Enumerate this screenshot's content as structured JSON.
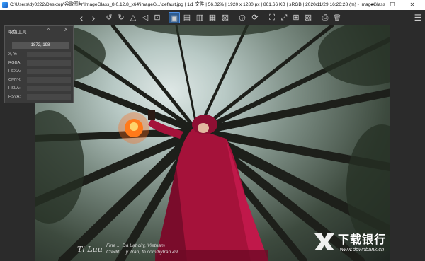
{
  "window": {
    "title": "C:\\Users\\dy0222\\Desktop\\谷歌图片\\ImageGlass_8.0.12.8_x64\\imageG...\\default.jpg  |  1/1 文件  |  56.02%  |  1920 x 1280 px  |  861.66 KB  |  sRGB  |  2020/11/29 16:26:28 (m)  -  ImageGlass",
    "minimize": "—",
    "maximize": "☐",
    "close": "✕"
  },
  "toolbar": {
    "buttons": [
      {
        "name": "prev-image-icon",
        "glyph": "‹"
      },
      {
        "name": "next-image-icon",
        "glyph": "›"
      },
      {
        "name": "rotate-left-icon",
        "glyph": "↺"
      },
      {
        "name": "rotate-right-icon",
        "glyph": "↻"
      },
      {
        "name": "flip-vertical-icon",
        "glyph": "△"
      },
      {
        "name": "flip-horizontal-icon",
        "glyph": "◁"
      },
      {
        "name": "crop-icon",
        "glyph": "⊡"
      },
      {
        "name": "auto-zoom-icon",
        "glyph": "▣"
      },
      {
        "name": "zoom-lock-icon",
        "glyph": "▤"
      },
      {
        "name": "scale-width-icon",
        "glyph": "▥"
      },
      {
        "name": "scale-height-icon",
        "glyph": "▦"
      },
      {
        "name": "fill-icon",
        "glyph": "▧"
      },
      {
        "name": "slideshow-icon",
        "glyph": "◶"
      },
      {
        "name": "refresh-icon",
        "glyph": "⟳"
      },
      {
        "name": "fullscreen-icon",
        "glyph": "⛶"
      },
      {
        "name": "window-fit-icon",
        "glyph": "⤢"
      },
      {
        "name": "thumbnail-icon",
        "glyph": "⊞"
      },
      {
        "name": "gallery-icon",
        "glyph": "▨"
      },
      {
        "name": "print-icon",
        "glyph": "⎙"
      },
      {
        "name": "delete-icon",
        "glyph": "🗑"
      },
      {
        "name": "menu-icon",
        "glyph": "☰"
      }
    ]
  },
  "picker": {
    "title": "取色工具",
    "expand": "^",
    "close": "X",
    "coordinates": "1872, 198",
    "rows": [
      {
        "label": "X, Y:"
      },
      {
        "label": "RGBA:"
      },
      {
        "label": "HEXA:"
      },
      {
        "label": "CMYK:"
      },
      {
        "label": "HSLA:"
      },
      {
        "label": "HSVA:"
      }
    ]
  },
  "photo": {
    "credit_line1": "Fine ... Đà Lạt city, Vietnam",
    "credit_line2": "Credit ... y Trần, fb.com/bytran.49",
    "signature": "Ti Luu"
  },
  "watermark": {
    "text": "下载银行",
    "url": "www.downbank.cn"
  }
}
